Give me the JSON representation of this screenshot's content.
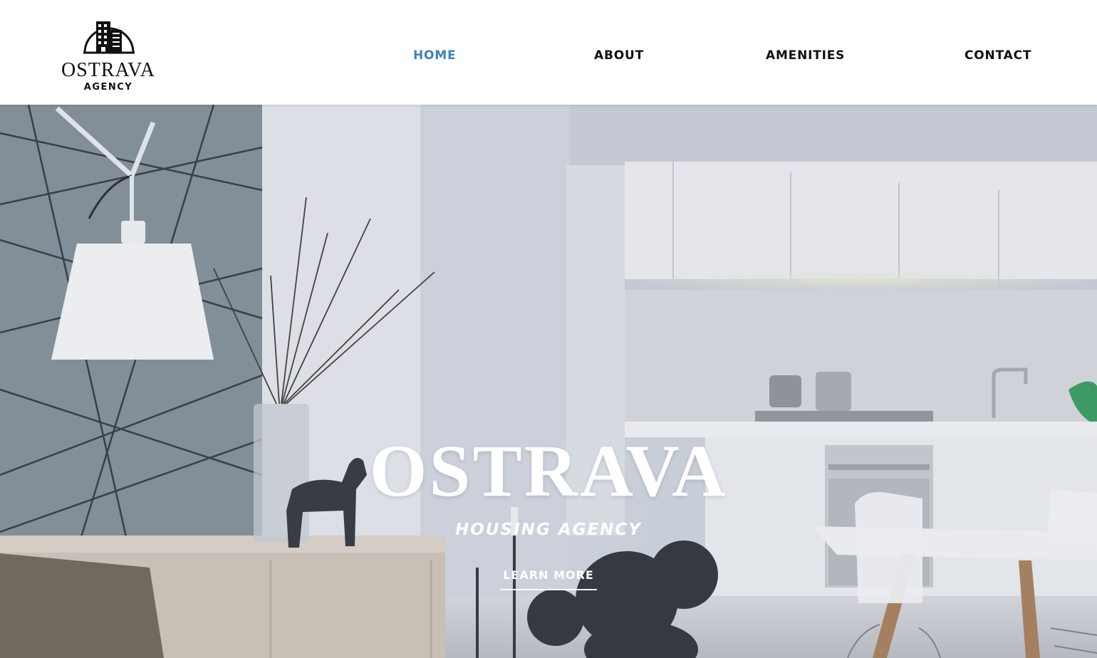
{
  "brand": {
    "name": "OSTRAVA",
    "tagline": "AGENCY",
    "logo_icon": "building-icon"
  },
  "nav": {
    "items": [
      {
        "label": "HOME",
        "active": true
      },
      {
        "label": "ABOUT",
        "active": false
      },
      {
        "label": "AMENITIES",
        "active": false
      },
      {
        "label": "CONTACT",
        "active": false
      }
    ]
  },
  "hero": {
    "title": "OSTRAVA",
    "subtitle": "HOUSING AGENCY",
    "cta_label": "LEARN MORE"
  },
  "colors": {
    "accent": "#3d82b5",
    "text": "#111111",
    "header_bg": "#ffffff",
    "hero_text": "#ffffff"
  }
}
